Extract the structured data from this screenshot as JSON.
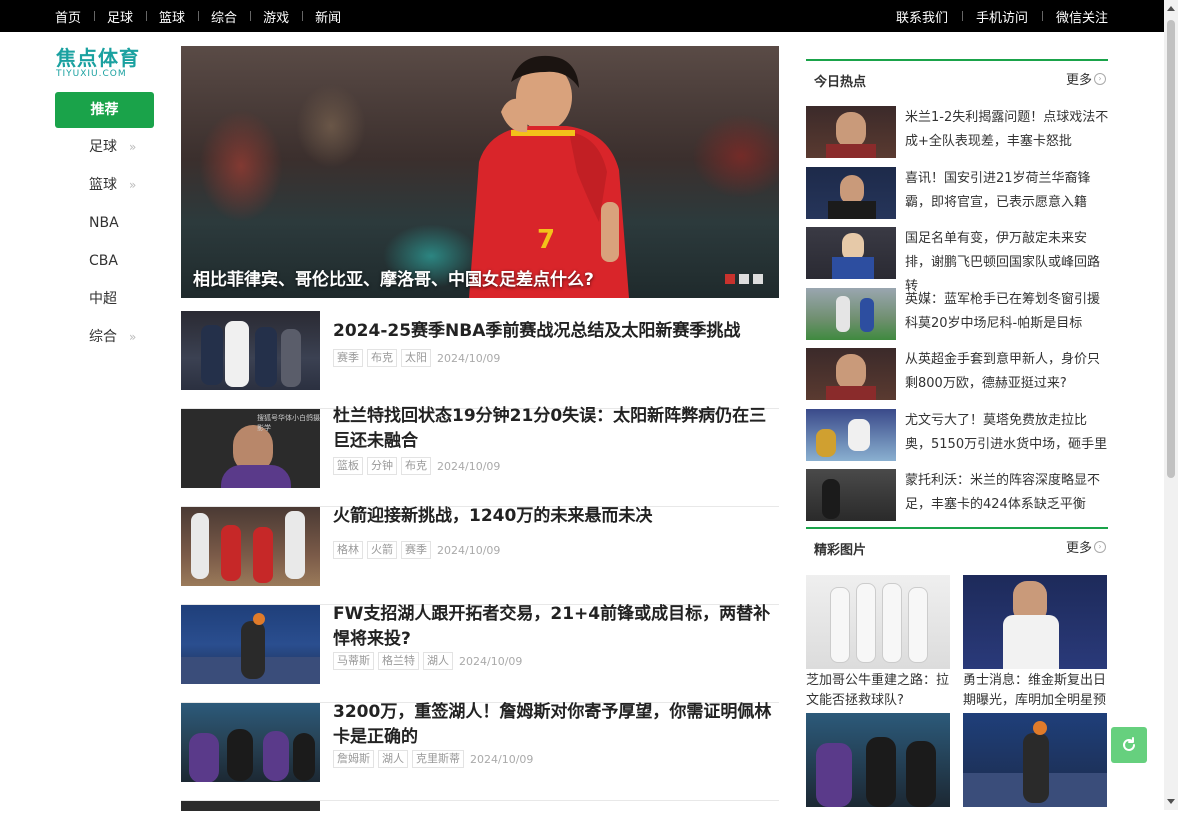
{
  "topnav": {
    "items": [
      "首页",
      "足球",
      "篮球",
      "综合",
      "游戏",
      "新闻"
    ]
  },
  "toplinks": [
    "联系我们",
    "手机访问",
    "微信关注"
  ],
  "logo": {
    "cn": "焦点体育",
    "en": "TIYUXIU.COM"
  },
  "leftnav": {
    "active": "推荐",
    "items": [
      {
        "label": "足球",
        "has_sub": true
      },
      {
        "label": "篮球",
        "has_sub": true
      },
      {
        "label": "NBA",
        "has_sub": false
      },
      {
        "label": "CBA",
        "has_sub": false
      },
      {
        "label": "中超",
        "has_sub": false
      },
      {
        "label": "综合",
        "has_sub": true
      }
    ]
  },
  "hero": {
    "caption": "相比菲律宾、哥伦比亚、摩洛哥、中国女足差点什么?",
    "slide_count": 3,
    "active_slide": 1,
    "jersey_number": "7"
  },
  "articles": [
    {
      "title": "2024-25赛季NBA季前赛战况总结及太阳新赛季挑战",
      "tags": [
        "赛季",
        "布克",
        "太阳"
      ],
      "date": "2024/10/09"
    },
    {
      "title": "杜兰特找回状态19分钟21分0失误：太阳新阵弊病仍在三巨还未融合",
      "tags": [
        "篮板",
        "分钟",
        "布克"
      ],
      "date": "2024/10/09",
      "thumb_caption": "搜狐号华体小白鸽摄影学"
    },
    {
      "title": "火箭迎接新挑战，1240万的未来悬而未决",
      "tags": [
        "格林",
        "火箭",
        "赛季"
      ],
      "date": "2024/10/09"
    },
    {
      "title": "FW支招湖人跟开拓者交易，21+4前锋或成目标，两替补悍将来投?",
      "tags": [
        "马蒂斯",
        "格兰特",
        "湖人"
      ],
      "date": "2024/10/09"
    },
    {
      "title": "3200万，重签湖人！詹姆斯对你寄予厚望，你需证明佩林卡是正确的",
      "tags": [
        "詹姆斯",
        "湖人",
        "克里斯蒂"
      ],
      "date": "2024/10/09"
    }
  ],
  "hot": {
    "heading": "今日热点",
    "more": "更多",
    "items": [
      {
        "text": "米兰1-2失利揭露问题！点球戏法不成+全队表现差，丰塞卡怒批"
      },
      {
        "text": "喜讯！国安引进21岁荷兰华裔锋霸，即将官宣，已表示愿意入籍"
      },
      {
        "text": "国足名单有变，伊万敲定未来安排，谢鹏飞巴顿回国家队或峰回路转"
      },
      {
        "text": "英媒：蓝军枪手已在筹划冬窗引援 科莫20岁中场尼科-帕斯是目标"
      },
      {
        "text": "从英超金手套到意甲新人，身价只剩800万欧，德赫亚挺过来?"
      },
      {
        "text": "尤文亏大了！莫塔免费放走拉比奥，5150万引进水货中场，砸手里"
      },
      {
        "text": "蒙托利沃：米兰的阵容深度略显不足，丰塞卡的424体系缺乏平衡"
      }
    ]
  },
  "pics": {
    "heading": "精彩图片",
    "more": "更多",
    "items": [
      {
        "caption": "芝加哥公牛重建之路：拉文能否拯救球队?"
      },
      {
        "caption": "勇士消息：维金斯复出日期曝光，库明加全明星预"
      },
      {
        "caption": ""
      },
      {
        "caption": ""
      }
    ]
  },
  "colors": {
    "accent": "#1aa34a",
    "topbar": "#000000",
    "logo": "#1aa1a0",
    "refresh": "#66d07e",
    "slide_active": "#c8322d"
  }
}
